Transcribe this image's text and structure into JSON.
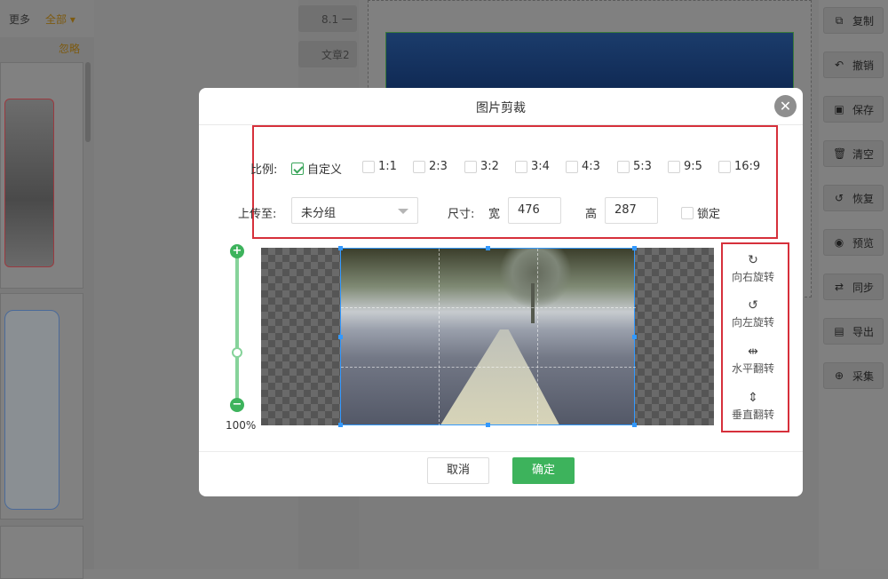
{
  "left_panel": {
    "more": "更多",
    "all": "全部 ▾",
    "ignore": "忽略"
  },
  "thumbs": [
    {
      "label": "8.1 一"
    },
    {
      "label": "文章2"
    }
  ],
  "right_toolbar": [
    {
      "label": "复制",
      "icon": "copy-icon",
      "glyph": "⧉"
    },
    {
      "label": "撤销",
      "icon": "undo-icon",
      "glyph": "↶"
    },
    {
      "label": "保存",
      "icon": "save-icon",
      "glyph": "▣"
    },
    {
      "label": "清空",
      "icon": "trash-icon",
      "glyph": "🗑"
    },
    {
      "label": "恢复",
      "icon": "restore-icon",
      "glyph": "↺"
    },
    {
      "label": "预览",
      "icon": "eye-icon",
      "glyph": "◉"
    },
    {
      "label": "同步",
      "icon": "sync-icon",
      "glyph": "⇄"
    },
    {
      "label": "导出",
      "icon": "export-icon",
      "glyph": "▤"
    },
    {
      "label": "采集",
      "icon": "search-plus-icon",
      "glyph": "⊕"
    }
  ],
  "modal": {
    "title": "图片剪裁",
    "ratio_label": "比例:",
    "ratios": [
      {
        "label": "自定义",
        "checked": true
      },
      {
        "label": "1:1",
        "checked": false
      },
      {
        "label": "2:3",
        "checked": false
      },
      {
        "label": "3:2",
        "checked": false
      },
      {
        "label": "3:4",
        "checked": false
      },
      {
        "label": "4:3",
        "checked": false
      },
      {
        "label": "5:3",
        "checked": false
      },
      {
        "label": "9:5",
        "checked": false
      },
      {
        "label": "16:9",
        "checked": false
      }
    ],
    "upload_label": "上传至:",
    "upload_value": "未分组",
    "size_label": "尺寸:",
    "width_label": "宽",
    "width_value": "476",
    "height_label": "高",
    "height_value": "287",
    "lock_label": "锁定",
    "zoom_percent": "100%",
    "tools": [
      {
        "label": "向右旋转",
        "icon": "rotate-right-icon",
        "glyph": "↻"
      },
      {
        "label": "向左旋转",
        "icon": "rotate-left-icon",
        "glyph": "↺"
      },
      {
        "label": "水平翻转",
        "icon": "flip-horizontal-icon",
        "glyph": "⇹"
      },
      {
        "label": "垂直翻转",
        "icon": "flip-vertical-icon",
        "glyph": "⇕"
      }
    ],
    "cancel": "取消",
    "confirm": "确定"
  }
}
